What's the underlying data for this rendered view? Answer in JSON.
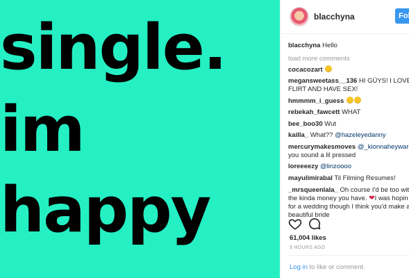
{
  "post_image": {
    "background": "#25f0c4",
    "lines": [
      "single.",
      "im",
      "happy"
    ]
  },
  "header": {
    "username": "blacchyna",
    "follow_label": "Follow",
    "follow_color": "#3897f0"
  },
  "caption": {
    "username": "blacchyna",
    "text": "Hello"
  },
  "load_more": "load more comments",
  "comments": [
    {
      "user": "cocacozart",
      "text": "",
      "emoji": "smile"
    },
    {
      "user": "megansweetass__136",
      "text": "HI GÜYS! I LOVE TO",
      "text2": "FLIRT AND HAVE SEX!"
    },
    {
      "user": "hmmmm_i_guess",
      "text": "",
      "emoji": "two-faces"
    },
    {
      "user": "rebekah_fawcett",
      "text": "WHAT"
    },
    {
      "user": "bee_boo30",
      "text": "Wut"
    },
    {
      "user": "kailla_",
      "text": "What?? ",
      "mention": "@hazeleyedanny"
    },
    {
      "user": "mercurymakesmoves",
      "mention": "@_kionnaheyward",
      "text2": "you sound a lil pressed"
    },
    {
      "user": "loreeeezy",
      "mention": "@linzoooo"
    },
    {
      "user": "mayulimirabal",
      "text": "Til Filming Resumes!"
    },
    {
      "user": "_mrsqueenlala_",
      "text": "Oh course I'd be too with",
      "text2": "the kinda money you have. ",
      "text3": "I was hopin",
      "text4": "for a wedding though I think you'd make a",
      "text5": "beautiful bride"
    }
  ],
  "actions": {
    "like_icon": "heart-icon",
    "comment_icon": "comment-bubble-icon"
  },
  "likes": "61,004 likes",
  "timestamp": "9 HOURS AGO",
  "footer": {
    "login_link": "Log in",
    "login_rest": " to like or comment."
  }
}
